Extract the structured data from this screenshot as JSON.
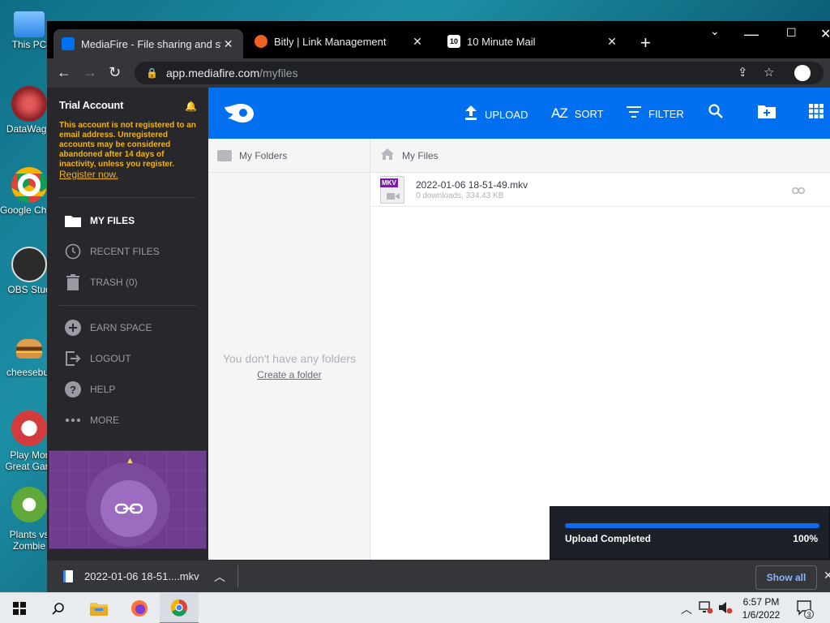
{
  "desktop": {
    "icons": [
      {
        "label": "This PC",
        "color": "#3d8ee8"
      },
      {
        "label": "DataWago",
        "color": "#b8343a"
      },
      {
        "label": "Google Chrome",
        "line2": "Chrome",
        "color": "#db4437"
      },
      {
        "label": "OBS Stud",
        "color": "#222"
      },
      {
        "label": "cheesebur",
        "color": "#c97a2a"
      },
      {
        "label": "Play Mor",
        "line2": "Great Gam",
        "color": "#d23c3c"
      },
      {
        "label": "Plants vs",
        "line2": "Zombie",
        "color": "#5fa83a"
      }
    ]
  },
  "browser": {
    "tabs": [
      {
        "title": "MediaFire - File sharing and stor",
        "favicon_color": "#0070f0"
      },
      {
        "title": "Bitly | Link Management",
        "favicon_color": "#ee6123"
      },
      {
        "title": "10 Minute Mail",
        "favicon_color": "#cccccc"
      }
    ],
    "url_host": "app.mediafire.com",
    "url_path": "/myfiles"
  },
  "sidebar": {
    "account_title": "Trial Account",
    "warning": "This account is not registered to an email address. Unregistered accounts may be considered abandoned after 14 days of inactivity, unless you register.",
    "register_link": "Register now.",
    "nav": [
      {
        "label": "MY FILES",
        "icon": "folder-icon",
        "active": true
      },
      {
        "label": "RECENT FILES",
        "icon": "clock-icon"
      },
      {
        "label": "TRASH (0)",
        "icon": "trash-icon"
      }
    ],
    "nav2": [
      {
        "label": "EARN SPACE",
        "icon": "plus-circle-icon"
      },
      {
        "label": "LOGOUT",
        "icon": "logout-icon"
      },
      {
        "label": "HELP",
        "icon": "help-icon"
      },
      {
        "label": "MORE",
        "icon": "more-icon"
      }
    ]
  },
  "topbar": {
    "upload": "UPLOAD",
    "sort": "SORT",
    "filter": "FILTER",
    "sort_icon_text": "AZ"
  },
  "folders_pane": {
    "title": "My Folders",
    "empty_text": "You don't have any folders",
    "create_link": "Create a folder"
  },
  "files_pane": {
    "title": "My Files",
    "files": [
      {
        "name": "2022-01-06 18-51-49.mkv",
        "meta": "0 downloads, 334.43 KB",
        "badge": "MKV"
      }
    ]
  },
  "upload_toast": {
    "label": "Upload Completed",
    "percent_text": "100%",
    "progress": 1.0
  },
  "download_bar": {
    "file": "2022-01-06 18-51....mkv",
    "show_all": "Show all"
  },
  "taskbar": {
    "time": "6:57 PM",
    "date": "1/6/2022",
    "notifications": "3"
  }
}
